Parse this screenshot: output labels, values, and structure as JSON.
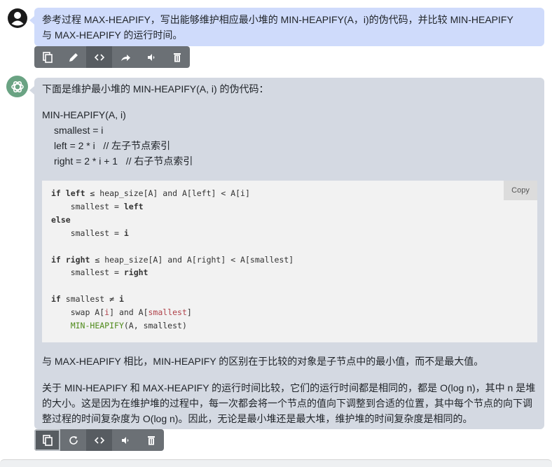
{
  "user_message": {
    "line1": "参考过程 MAX-HEAPIFY，写出能够维护相应最小堆的 MIN-HEAPIFY(A，i)的伪代码，并比较 MIN-HEAPIFY",
    "line2": "与 MAX-HEAPIFY 的运行时间。"
  },
  "user_toolbar": [
    "copy-icon",
    "edit-icon",
    "code-icon",
    "share-icon",
    "speaker-icon",
    "trash-icon"
  ],
  "assistant_message": {
    "intro": "下面是维护最小堆的 MIN-HEAPIFY(A, i) 的伪代码：",
    "pseudo": [
      "MIN-HEAPIFY(A, i)",
      "smallest = i",
      "left = 2 * i   // 左子节点索引",
      "right = 2 * i + 1   // 右子节点索引"
    ],
    "code_copy_label": "Copy",
    "code": {
      "l1a": "if",
      "l1b": "left",
      "l1c": " ≤ heap_size[A] and A[left] < A[i]",
      "l2a": "    smallest = ",
      "l2b": "left",
      "l3": "else",
      "l4a": "    smallest = ",
      "l4b": "i",
      "l6a": "if",
      "l6b": "right",
      "l6c": " ≤ heap_size[A] and A[right] < A[smallest]",
      "l7a": "    smallest = ",
      "l7b": "right",
      "l9a": "if",
      "l9b": " smallest ≠ ",
      "l9c": "i",
      "l10a": "    swap A[",
      "l10b": "i",
      "l10c": "] and A[",
      "l10d": "smallest",
      "l10e": "]",
      "l11a": "    ",
      "l11b": "MIN-HEAPIFY",
      "l11c": "(A, smallest)"
    },
    "para1": "与 MAX-HEAPIFY 相比，MIN-HEAPIFY 的区别在于比较的对象是子节点中的最小值，而不是最大值。",
    "para2": "关于 MIN-HEAPIFY 和 MAX-HEAPIFY 的运行时间比较，它们的运行时间都是相同的，都是 O(log n)，其中 n 是堆的大小。这是因为在维护堆的过程中，每一次都会将一个节点的值向下调整到合适的位置，其中每个节点的向下调整过程的时间复杂度为 O(log n)。因此，无论是最小堆还是最大堆，维护堆的时间复杂度是相同的。"
  },
  "assistant_toolbar": [
    "copy-icon",
    "regenerate-icon",
    "code-icon",
    "speaker-icon",
    "trash-icon"
  ]
}
